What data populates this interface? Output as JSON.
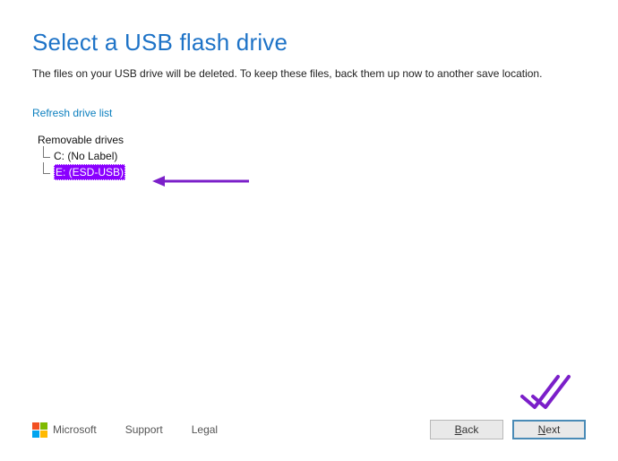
{
  "title": "Select a USB flash drive",
  "subtitle": "The files on your USB drive will be deleted. To keep these files, back them up now to another save location.",
  "refresh_label": "Refresh drive list",
  "tree": {
    "root": "Removable drives",
    "items": [
      {
        "label": "C: (No Label)",
        "selected": false
      },
      {
        "label": "E: (ESD-USB)",
        "selected": true
      }
    ]
  },
  "footer": {
    "brand": "Microsoft",
    "support": "Support",
    "legal": "Legal",
    "back": "Back",
    "next": "Next"
  },
  "colors": {
    "accent": "#1e73c7",
    "highlight": "#8a00ff",
    "annotation": "#7b1fc9"
  }
}
